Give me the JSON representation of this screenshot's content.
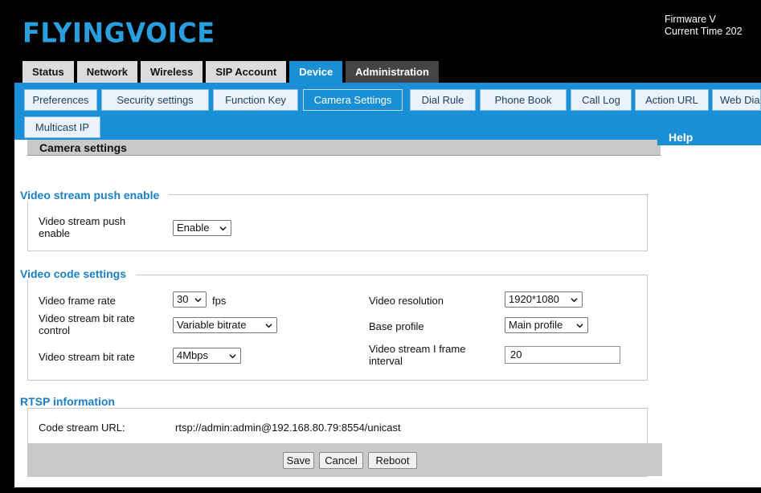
{
  "header": {
    "logo": "FLYINGVOICE",
    "firmware_label": "Firmware V",
    "current_time_label": "Current Time 202"
  },
  "main_tabs": [
    {
      "label": "Status"
    },
    {
      "label": "Network"
    },
    {
      "label": "Wireless"
    },
    {
      "label": "SIP Account"
    },
    {
      "label": "Device"
    },
    {
      "label": "Administration"
    }
  ],
  "sub_tabs": [
    {
      "label": "Preferences"
    },
    {
      "label": "Security settings"
    },
    {
      "label": "Function Key"
    },
    {
      "label": "Camera Settings"
    },
    {
      "label": "Dial Rule"
    },
    {
      "label": "Phone Book"
    },
    {
      "label": "Call Log"
    },
    {
      "label": "Action URL"
    },
    {
      "label": "Web Dia"
    },
    {
      "label": "Multicast IP"
    }
  ],
  "page": {
    "section_title": "Camera settings",
    "help_title": "Help"
  },
  "push": {
    "group_title": "Video stream push enable",
    "label_line1": "Video stream push",
    "label_line2": "enable",
    "value": "Enable"
  },
  "code": {
    "group_title": "Video code settings",
    "frame_rate_label": "Video frame rate",
    "frame_rate_value": "30",
    "frame_rate_unit": "fps",
    "bitrate_control_label_line1": "Video stream bit rate",
    "bitrate_control_label_line2": "control",
    "bitrate_control_value": "Variable bitrate",
    "bitrate_label": "Video stream bit rate",
    "bitrate_value": "4Mbps",
    "resolution_label": "Video resolution",
    "resolution_value": "1920*1080",
    "profile_label": "Base profile",
    "profile_value": "Main profile",
    "iframe_label_line1": "Video stream I frame",
    "iframe_label_line2": "interval",
    "iframe_value": "20"
  },
  "rtsp": {
    "group_title": "RTSP information",
    "url_label": "Code stream URL:",
    "url_value": "rtsp://admin:admin@192.168.80.79:8554/unicast"
  },
  "buttons": {
    "save": "Save",
    "cancel": "Cancel",
    "reboot": "Reboot"
  },
  "colors": {
    "accent": "#1a8fd6",
    "logo": "#2a9fe0",
    "group_title": "#1a7fc8",
    "header_bg": "#000000"
  }
}
